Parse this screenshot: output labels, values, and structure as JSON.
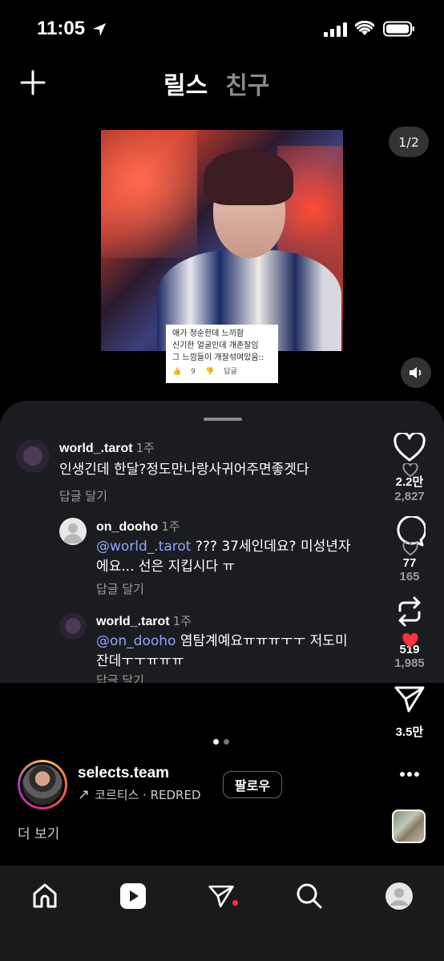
{
  "status_bar": {
    "time": "11:05"
  },
  "header": {
    "tabs": [
      {
        "label": "릴스",
        "active": true
      },
      {
        "label": "친구",
        "active": false
      }
    ]
  },
  "media": {
    "page_indicator": "1/2",
    "caption": {
      "lines": [
        "애가 청순한데 느끼함",
        "신기한 얼굴인데 개존잘임",
        "그 느낌들이 개잘섞여있음::"
      ],
      "likes": "9",
      "reply": "답글"
    }
  },
  "comments": [
    {
      "user": "world_.tarot",
      "time": "1주",
      "text": "인생긴데 한달?정도만나랑사귀어주면좋겟다",
      "reply_label": "답글 달기"
    },
    {
      "user": "on_dooho",
      "time": "1주",
      "mention": "@world_.tarot",
      "text_line1": " ??? 37세인데요? 미성년자",
      "text_line2": "에요... 선은 지킵시다 ㅠ",
      "reply_label": "답글 달기"
    },
    {
      "user": "world_.tarot",
      "time": "1주",
      "mention": "@on_dooho",
      "text_line1": " 염탐계예요ㅠㅠㅠㅜㅜ 저도미",
      "text_line2": "잔데ㅜㅜㅠㅠㅠ",
      "reply_label": "답글 달기"
    }
  ],
  "side_actions": {
    "like": {
      "count": "2.2만",
      "comment_like_count": "2,827"
    },
    "comment": {
      "count": "77",
      "comment_like_count": "165"
    },
    "repost": {
      "count": "519",
      "comment_like_count": "1,985"
    },
    "share": {
      "count": "3.5만"
    }
  },
  "profile": {
    "username": "selects.team",
    "audio": "코르티스 · REDRED",
    "follow_label": "팔로우",
    "more_label": "더 보기"
  },
  "colors": {
    "accent_mention": "#8fa4ff",
    "notification_dot": "#ff3040",
    "like_red": "#ff3040"
  },
  "icons": [
    "location-arrow-icon",
    "signal-icon",
    "wifi-icon",
    "battery-icon",
    "plus-icon",
    "sound-icon",
    "heart-icon",
    "comment-icon",
    "repost-icon",
    "send-icon",
    "more-icon",
    "home-icon",
    "reels-icon",
    "direct-icon",
    "search-icon",
    "profile-icon"
  ]
}
